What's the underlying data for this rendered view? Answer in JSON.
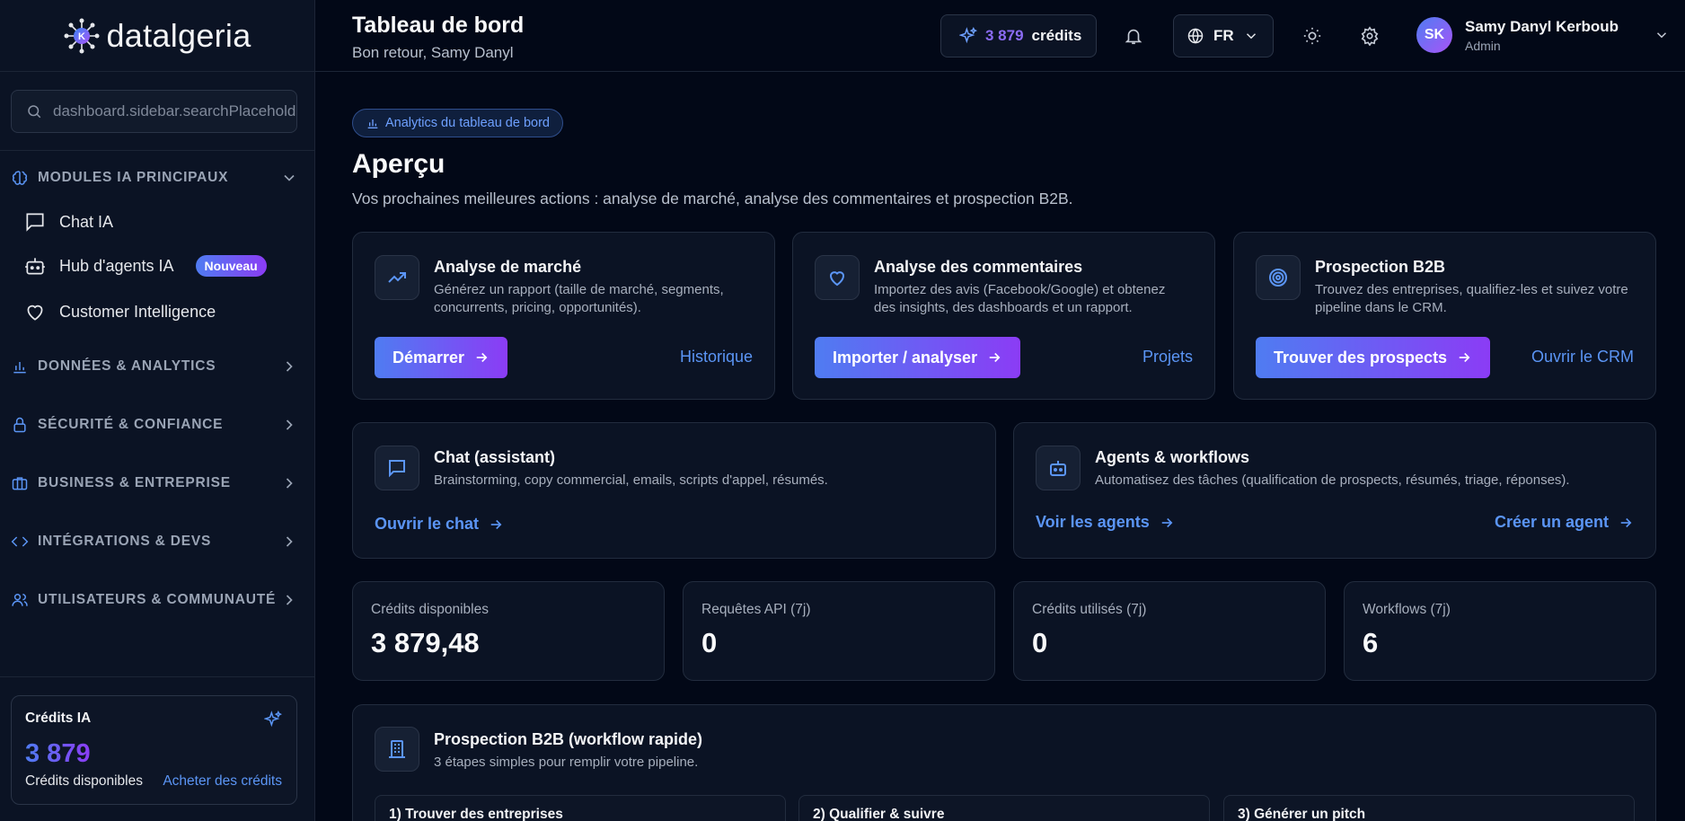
{
  "brand": {
    "logo_text": "datalgeria"
  },
  "sidebar": {
    "search_placeholder": "dashboard.sidebar.searchPlaceholder",
    "section_main": "MODULES IA PRINCIPAUX",
    "items": [
      {
        "label": "Chat IA",
        "icon": "message-square-icon"
      },
      {
        "label": "Hub d'agents IA",
        "icon": "bot-icon",
        "badge": "Nouveau"
      },
      {
        "label": "Customer Intelligence",
        "icon": "heart-icon"
      }
    ],
    "sections": [
      {
        "label": "DONNÉES & ANALYTICS",
        "icon": "bar-chart-icon"
      },
      {
        "label": "SÉCURITÉ & CONFIANCE",
        "icon": "lock-icon"
      },
      {
        "label": "BUSINESS & ENTREPRISE",
        "icon": "briefcase-icon"
      },
      {
        "label": "INTÉGRATIONS & DEVS",
        "icon": "code-icon"
      },
      {
        "label": "UTILISATEURS & COMMUNAUTÉ",
        "icon": "users-icon"
      }
    ],
    "credits": {
      "title": "Crédits IA",
      "amount": "3 879",
      "label": "Crédits disponibles",
      "buy": "Acheter des crédits"
    }
  },
  "header": {
    "title": "Tableau de bord",
    "subtitle": "Bon retour, Samy Danyl",
    "credits_amount": "3 879",
    "credits_word": "crédits",
    "language": "FR",
    "user": {
      "initials": "SK",
      "name": "Samy Danyl Kerboub",
      "role": "Admin"
    }
  },
  "main": {
    "chip": "Analytics du tableau de bord",
    "title": "Aperçu",
    "subtitle": "Vos prochaines meilleures actions : analyse de marché, analyse des commentaires et prospection B2B.",
    "action_cards": [
      {
        "title": "Analyse de marché",
        "desc1": "Générez un rapport (taille de marché, segments,",
        "desc2": "concurrents, pricing, opportunités).",
        "button": "Démarrer",
        "link": "Historique"
      },
      {
        "title": "Analyse des commentaires",
        "desc1": "Importez des avis (Facebook/Google) et obtenez",
        "desc2": "des insights, des dashboards et un rapport.",
        "button": "Importer / analyser",
        "link": "Projets"
      },
      {
        "title": "Prospection B2B",
        "desc1": "Trouvez des entreprises, qualifiez-les et suivez votre",
        "desc2": "pipeline dans le CRM.",
        "button": "Trouver des prospects",
        "link": "Ouvrir le CRM"
      }
    ],
    "chat_card": {
      "title": "Chat (assistant)",
      "desc": "Brainstorming, copy commercial, emails, scripts d'appel, résumés.",
      "link": "Ouvrir le chat"
    },
    "agents_card": {
      "title": "Agents & workflows",
      "desc": "Automatisez des tâches (qualification de prospects, résumés, triage, réponses).",
      "link1": "Voir les agents",
      "link2": "Créer un agent"
    },
    "stats": [
      {
        "label": "Crédits disponibles",
        "value": "3 879,48"
      },
      {
        "label": "Requêtes API (7j)",
        "value": "0"
      },
      {
        "label": "Crédits utilisés (7j)",
        "value": "0"
      },
      {
        "label": "Workflows (7j)",
        "value": "6"
      }
    ],
    "workflow": {
      "title": "Prospection B2B (workflow rapide)",
      "desc": "3 étapes simples pour remplir votre pipeline.",
      "steps": [
        "1) Trouver des entreprises",
        "2) Qualifier & suivre",
        "3) Générer un pitch"
      ]
    }
  },
  "colors": {
    "accent_start": "#4f7cf2",
    "accent_end": "#8b3cf5",
    "link": "#5b95f5",
    "background": "#020817"
  }
}
